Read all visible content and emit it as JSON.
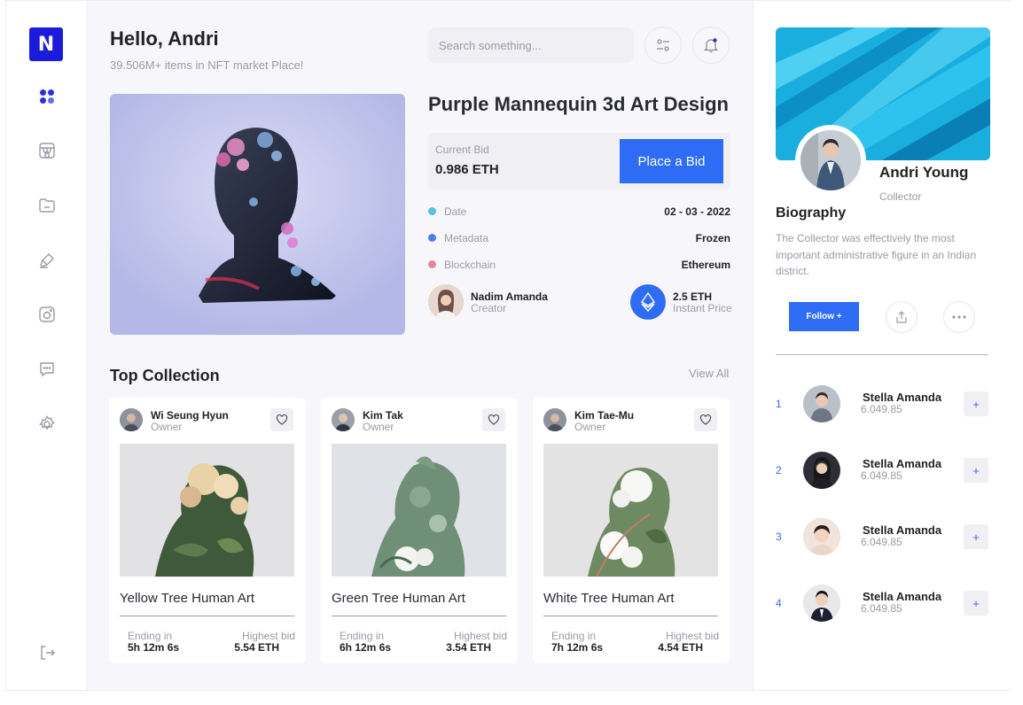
{
  "brand": {
    "logo_letter": "N",
    "accent": "#2f6cf6",
    "logo_bg": "#1b1bdc"
  },
  "sidebar": {
    "items": [
      {
        "icon": "dashboard-icon",
        "active": true
      },
      {
        "icon": "store-icon"
      },
      {
        "icon": "folder-icon"
      },
      {
        "icon": "brush-icon"
      },
      {
        "icon": "camera-icon"
      },
      {
        "icon": "chat-icon"
      },
      {
        "icon": "gear-icon"
      }
    ],
    "logout_icon": "logout-icon"
  },
  "header": {
    "greeting": "Hello, Andri",
    "subtitle": "39.506M+ items in NFT market Place!",
    "search_placeholder": "Search something...",
    "filter_icon": "filter-icon",
    "bell_icon": "bell-icon"
  },
  "featured": {
    "title": "Purple Mannequin 3d Art Design",
    "current_bid_label": "Current Bid",
    "current_bid_value": "0.986 ETH",
    "bid_button": "Place a Bid",
    "meta": [
      {
        "key": "Date",
        "value": "02 - 03 - 2022",
        "color": "#4fc3e0"
      },
      {
        "key": "Metadata",
        "value": "Frozen",
        "color": "#4e7df0"
      },
      {
        "key": "Blockchain",
        "value": "Ethereum",
        "color": "#e08a99"
      }
    ],
    "creator_name": "Nadim Amanda",
    "creator_role": "Creator",
    "price_value": "2.5 ETH",
    "price_label": "Instant Price"
  },
  "collection": {
    "title": "Top Collection",
    "view_all": "View All",
    "cards": [
      {
        "owner": "Wi Seung Hyun",
        "owner_label": "Owner",
        "title": "Yellow Tree Human Art",
        "ending_label": "Ending in",
        "ending": "5h 12m 6s",
        "bid_label": "Highest bid",
        "bid": "5.54 ETH"
      },
      {
        "owner": "Kim Tak",
        "owner_label": "Owner",
        "title": "Green Tree Human Art",
        "ending_label": "Ending in",
        "ending": "6h 12m 6s",
        "bid_label": "Highest bid",
        "bid": "3.54 ETH"
      },
      {
        "owner": "Kim Tae-Mu",
        "owner_label": "Owner",
        "title": "White Tree Human Art",
        "ending_label": "Ending in",
        "ending": "7h 12m 6s",
        "bid_label": "Highest bid",
        "bid": "4.54 ETH"
      }
    ]
  },
  "profile": {
    "name": "Andri Young",
    "role": "Collector",
    "bio_title": "Biography",
    "bio": "The Collector was effectively the most important administrative figure in an Indian district.",
    "follow_button": "Follow +",
    "share_icon": "share-icon",
    "more_icon": "more-icon"
  },
  "ranking": [
    {
      "rank": "1",
      "name": "Stella Amanda",
      "value": "6.049.85",
      "action": "+"
    },
    {
      "rank": "2",
      "name": "Stella Amanda",
      "value": "6.049.85",
      "action": "+"
    },
    {
      "rank": "3",
      "name": "Stella Amanda",
      "value": "6.049.85",
      "action": "+"
    },
    {
      "rank": "4",
      "name": "Stella Amanda",
      "value": "6.049.85",
      "action": "+"
    }
  ]
}
